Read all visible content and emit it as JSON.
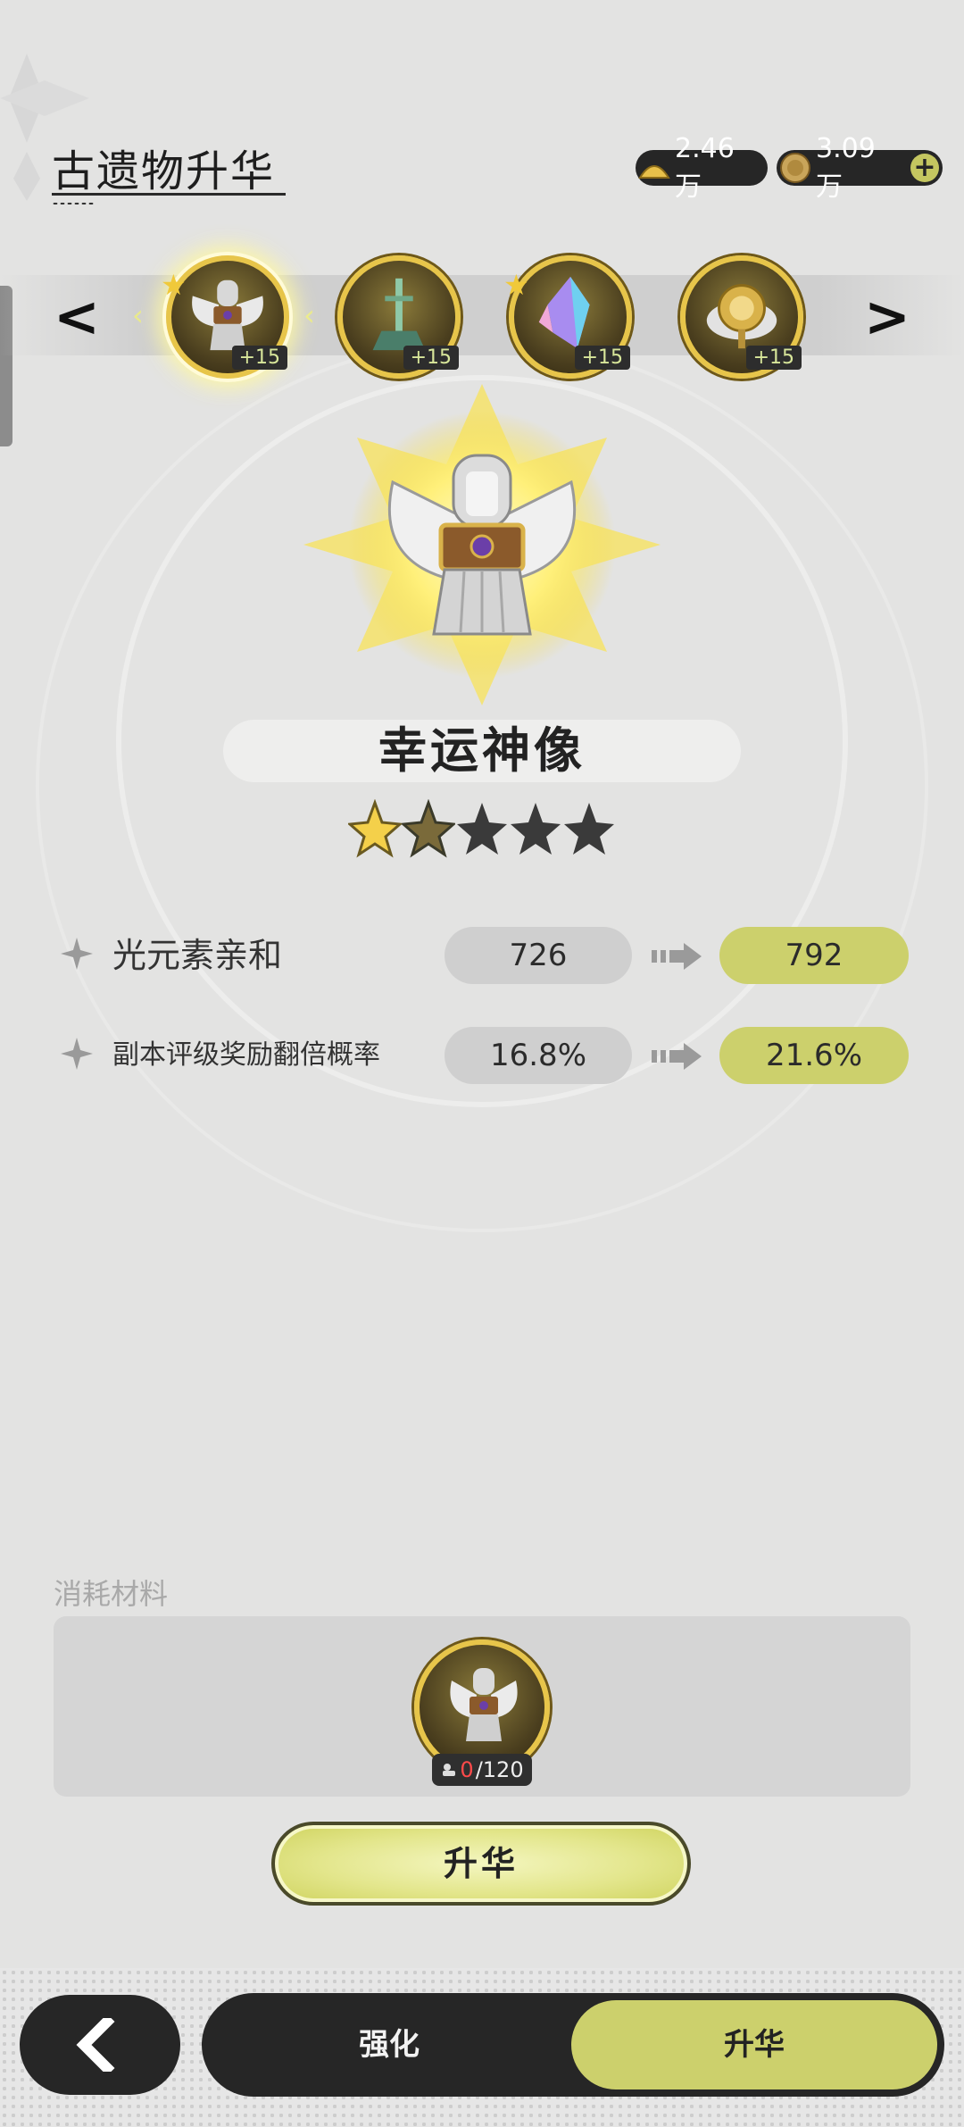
{
  "header": {
    "title": "古遗物升华",
    "currencies": [
      {
        "icon": "gold-pile-icon",
        "value": "2.46万"
      },
      {
        "icon": "coin-icon",
        "value": "3.09万"
      }
    ],
    "add_icon": "+"
  },
  "relic_selector": {
    "prev": "<",
    "next": ">",
    "items": [
      {
        "name": "幸运神像",
        "level": "+15",
        "selected": true,
        "starred": true
      },
      {
        "name": "relic-sword-statue",
        "level": "+15",
        "selected": false,
        "starred": false
      },
      {
        "name": "relic-crystal",
        "level": "+15",
        "selected": false,
        "starred": true
      },
      {
        "name": "relic-compass",
        "level": "+15",
        "selected": false,
        "starred": false
      }
    ]
  },
  "relic": {
    "name": "幸运神像",
    "stars_filled": 1,
    "stars_half": 1,
    "stars_total": 5
  },
  "stats": [
    {
      "label": "光元素亲和",
      "old": "726",
      "new": "792"
    },
    {
      "label": "副本评级奖励翻倍概率",
      "old": "16.8%",
      "new": "21.6%"
    }
  ],
  "materials": {
    "label": "消耗材料",
    "have": "0",
    "need": "/120"
  },
  "ascend_button": "升华",
  "tabs": {
    "enhance": "强化",
    "ascend": "升华"
  },
  "colors": {
    "accent": "#ccd06c",
    "background": "#e3e3e2",
    "dark": "#262626",
    "gold": "#e7c54a"
  }
}
